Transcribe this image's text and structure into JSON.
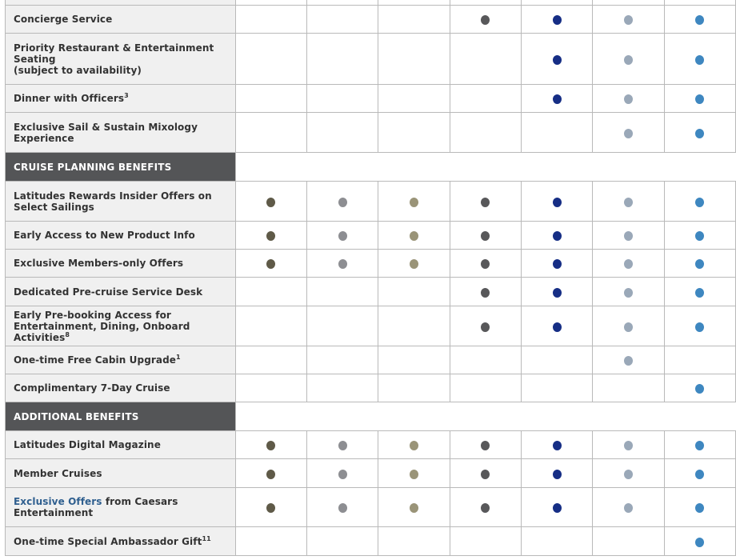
{
  "colors": {
    "tier_dots": [
      "#5f5a48",
      "#8d8e92",
      "#9a9478",
      "#58585a",
      "#162e85",
      "#9aa8b8",
      "#3e87c0"
    ],
    "section_header_bg": "#545557",
    "label_bg": "#f0f0f0",
    "link": "#2f5f8f"
  },
  "rows": [
    {
      "type": "benefit",
      "label": "",
      "tiers": [
        false,
        false,
        false,
        false,
        false,
        false,
        false
      ],
      "partial": true
    },
    {
      "type": "benefit",
      "label": "Concierge Service",
      "tiers": [
        false,
        false,
        false,
        true,
        true,
        true,
        true
      ]
    },
    {
      "type": "benefit",
      "label": "Priority Restaurant & Entertainment Seating",
      "label_line2": "(subject to availability)",
      "tiers": [
        false,
        false,
        false,
        false,
        true,
        true,
        true
      ]
    },
    {
      "type": "benefit",
      "label": "Dinner with Officers",
      "sup": "3",
      "tiers": [
        false,
        false,
        false,
        false,
        true,
        true,
        true
      ]
    },
    {
      "type": "benefit",
      "label": "Exclusive Sail & Sustain Mixology Experience",
      "tiers": [
        false,
        false,
        false,
        false,
        false,
        true,
        true
      ]
    },
    {
      "type": "section",
      "label": "CRUISE PLANNING BENEFITS"
    },
    {
      "type": "benefit",
      "label": "Latitudes Rewards Insider Offers on Select Sailings",
      "tiers": [
        true,
        true,
        true,
        true,
        true,
        true,
        true
      ]
    },
    {
      "type": "benefit",
      "label": "Early Access to New Product Info",
      "tiers": [
        true,
        true,
        true,
        true,
        true,
        true,
        true
      ]
    },
    {
      "type": "benefit",
      "label": "Exclusive Members-only Offers",
      "tiers": [
        true,
        true,
        true,
        true,
        true,
        true,
        true
      ]
    },
    {
      "type": "benefit",
      "label": "Dedicated Pre-cruise Service Desk",
      "tiers": [
        false,
        false,
        false,
        true,
        true,
        true,
        true
      ]
    },
    {
      "type": "benefit",
      "label": "Early Pre-booking Access for Entertainment, Dining, Onboard Activities",
      "sup": "8",
      "tiers": [
        false,
        false,
        false,
        true,
        true,
        true,
        true
      ]
    },
    {
      "type": "benefit",
      "label": "One-time Free Cabin Upgrade",
      "sup": "1",
      "tiers": [
        false,
        false,
        false,
        false,
        false,
        true,
        false
      ]
    },
    {
      "type": "benefit",
      "label": "Complimentary 7-Day Cruise",
      "tiers": [
        false,
        false,
        false,
        false,
        false,
        false,
        true
      ]
    },
    {
      "type": "section",
      "label": "ADDITIONAL BENEFITS"
    },
    {
      "type": "benefit",
      "label": "Latitudes Digital Magazine",
      "tiers": [
        true,
        true,
        true,
        true,
        true,
        true,
        true
      ]
    },
    {
      "type": "benefit",
      "label": "Member Cruises",
      "tiers": [
        true,
        true,
        true,
        true,
        true,
        true,
        true
      ]
    },
    {
      "type": "benefit",
      "link_text": "Exclusive Offers",
      "label": " from Caesars Entertainment",
      "tiers": [
        true,
        true,
        true,
        true,
        true,
        true,
        true
      ]
    },
    {
      "type": "benefit",
      "label": "One-time Special Ambassador Gift",
      "sup": "11",
      "tiers": [
        false,
        false,
        false,
        false,
        false,
        false,
        true
      ]
    }
  ]
}
